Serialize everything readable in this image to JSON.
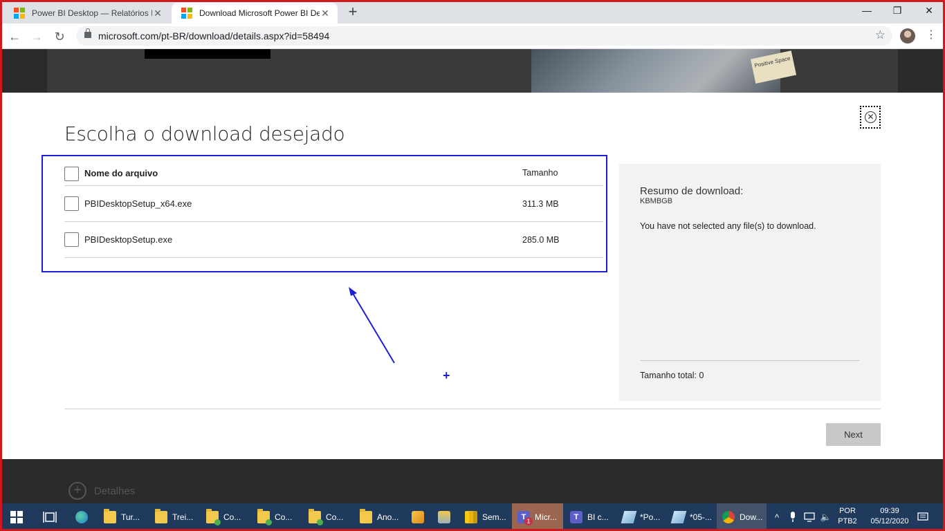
{
  "browser": {
    "tabs": [
      {
        "title": "Power BI Desktop — Relatórios Ir",
        "active": false
      },
      {
        "title": "Download Microsoft Power BI De",
        "active": true
      }
    ],
    "url": "microsoft.com/pt-BR/download/details.aspx?id=58494",
    "window_controls": {
      "minimize": "—",
      "maximize": "❐",
      "close": "✕"
    }
  },
  "hero": {
    "tag_text": "Positive Space"
  },
  "dialog": {
    "title": "Escolha o download desejado",
    "columns": {
      "name": "Nome do arquivo",
      "size": "Tamanho"
    },
    "files": [
      {
        "name": "PBIDesktopSetup_x64.exe",
        "size": "311.3 MB"
      },
      {
        "name": "PBIDesktopSetup.exe",
        "size": "285.0 MB"
      }
    ],
    "summary": {
      "title": "Resumo de download:",
      "units": "KBMBGB",
      "message": "You have not selected any file(s) to download.",
      "total": "Tamanho total: 0"
    },
    "next_label": "Next"
  },
  "details": {
    "label": "Detalhes"
  },
  "taskbar": {
    "items": [
      {
        "label": "Tur...",
        "icon": "folder-icon"
      },
      {
        "label": "Trei...",
        "icon": "folder-icon"
      },
      {
        "label": "Co...",
        "icon": "folder-sync-icon"
      },
      {
        "label": "Co...",
        "icon": "folder-sync-icon"
      },
      {
        "label": "Co...",
        "icon": "folder-sync-icon"
      },
      {
        "label": "Ano...",
        "icon": "folder-icon"
      },
      {
        "label": "Sem...",
        "icon": "power-bi-icon"
      },
      {
        "label": "Micr...",
        "icon": "teams-icon",
        "badge": "1"
      },
      {
        "label": "BI c...",
        "icon": "teams-icon"
      },
      {
        "label": "*Po...",
        "icon": "notepad-icon"
      },
      {
        "label": "*05-...",
        "icon": "notepad-icon"
      },
      {
        "label": "Dow...",
        "icon": "chrome-icon"
      }
    ],
    "lang": [
      "POR",
      "PTB2"
    ],
    "time": "09:39",
    "date": "05/12/2020"
  },
  "colors": {
    "highlight": "#1d1fd6",
    "recording_border": "#d0181f",
    "taskbar": "#1f3a5c"
  }
}
